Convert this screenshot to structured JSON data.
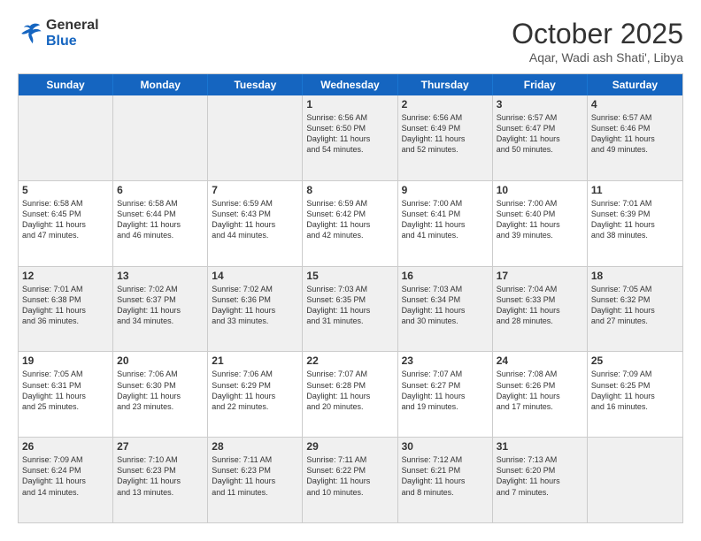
{
  "header": {
    "logo_line1": "General",
    "logo_line2": "Blue",
    "month": "October 2025",
    "location": "Aqar, Wadi ash Shati', Libya"
  },
  "day_headers": [
    "Sunday",
    "Monday",
    "Tuesday",
    "Wednesday",
    "Thursday",
    "Friday",
    "Saturday"
  ],
  "weeks": [
    [
      {
        "day": "",
        "info": ""
      },
      {
        "day": "",
        "info": ""
      },
      {
        "day": "",
        "info": ""
      },
      {
        "day": "1",
        "info": "Sunrise: 6:56 AM\nSunset: 6:50 PM\nDaylight: 11 hours\nand 54 minutes."
      },
      {
        "day": "2",
        "info": "Sunrise: 6:56 AM\nSunset: 6:49 PM\nDaylight: 11 hours\nand 52 minutes."
      },
      {
        "day": "3",
        "info": "Sunrise: 6:57 AM\nSunset: 6:47 PM\nDaylight: 11 hours\nand 50 minutes."
      },
      {
        "day": "4",
        "info": "Sunrise: 6:57 AM\nSunset: 6:46 PM\nDaylight: 11 hours\nand 49 minutes."
      }
    ],
    [
      {
        "day": "5",
        "info": "Sunrise: 6:58 AM\nSunset: 6:45 PM\nDaylight: 11 hours\nand 47 minutes."
      },
      {
        "day": "6",
        "info": "Sunrise: 6:58 AM\nSunset: 6:44 PM\nDaylight: 11 hours\nand 46 minutes."
      },
      {
        "day": "7",
        "info": "Sunrise: 6:59 AM\nSunset: 6:43 PM\nDaylight: 11 hours\nand 44 minutes."
      },
      {
        "day": "8",
        "info": "Sunrise: 6:59 AM\nSunset: 6:42 PM\nDaylight: 11 hours\nand 42 minutes."
      },
      {
        "day": "9",
        "info": "Sunrise: 7:00 AM\nSunset: 6:41 PM\nDaylight: 11 hours\nand 41 minutes."
      },
      {
        "day": "10",
        "info": "Sunrise: 7:00 AM\nSunset: 6:40 PM\nDaylight: 11 hours\nand 39 minutes."
      },
      {
        "day": "11",
        "info": "Sunrise: 7:01 AM\nSunset: 6:39 PM\nDaylight: 11 hours\nand 38 minutes."
      }
    ],
    [
      {
        "day": "12",
        "info": "Sunrise: 7:01 AM\nSunset: 6:38 PM\nDaylight: 11 hours\nand 36 minutes."
      },
      {
        "day": "13",
        "info": "Sunrise: 7:02 AM\nSunset: 6:37 PM\nDaylight: 11 hours\nand 34 minutes."
      },
      {
        "day": "14",
        "info": "Sunrise: 7:02 AM\nSunset: 6:36 PM\nDaylight: 11 hours\nand 33 minutes."
      },
      {
        "day": "15",
        "info": "Sunrise: 7:03 AM\nSunset: 6:35 PM\nDaylight: 11 hours\nand 31 minutes."
      },
      {
        "day": "16",
        "info": "Sunrise: 7:03 AM\nSunset: 6:34 PM\nDaylight: 11 hours\nand 30 minutes."
      },
      {
        "day": "17",
        "info": "Sunrise: 7:04 AM\nSunset: 6:33 PM\nDaylight: 11 hours\nand 28 minutes."
      },
      {
        "day": "18",
        "info": "Sunrise: 7:05 AM\nSunset: 6:32 PM\nDaylight: 11 hours\nand 27 minutes."
      }
    ],
    [
      {
        "day": "19",
        "info": "Sunrise: 7:05 AM\nSunset: 6:31 PM\nDaylight: 11 hours\nand 25 minutes."
      },
      {
        "day": "20",
        "info": "Sunrise: 7:06 AM\nSunset: 6:30 PM\nDaylight: 11 hours\nand 23 minutes."
      },
      {
        "day": "21",
        "info": "Sunrise: 7:06 AM\nSunset: 6:29 PM\nDaylight: 11 hours\nand 22 minutes."
      },
      {
        "day": "22",
        "info": "Sunrise: 7:07 AM\nSunset: 6:28 PM\nDaylight: 11 hours\nand 20 minutes."
      },
      {
        "day": "23",
        "info": "Sunrise: 7:07 AM\nSunset: 6:27 PM\nDaylight: 11 hours\nand 19 minutes."
      },
      {
        "day": "24",
        "info": "Sunrise: 7:08 AM\nSunset: 6:26 PM\nDaylight: 11 hours\nand 17 minutes."
      },
      {
        "day": "25",
        "info": "Sunrise: 7:09 AM\nSunset: 6:25 PM\nDaylight: 11 hours\nand 16 minutes."
      }
    ],
    [
      {
        "day": "26",
        "info": "Sunrise: 7:09 AM\nSunset: 6:24 PM\nDaylight: 11 hours\nand 14 minutes."
      },
      {
        "day": "27",
        "info": "Sunrise: 7:10 AM\nSunset: 6:23 PM\nDaylight: 11 hours\nand 13 minutes."
      },
      {
        "day": "28",
        "info": "Sunrise: 7:11 AM\nSunset: 6:23 PM\nDaylight: 11 hours\nand 11 minutes."
      },
      {
        "day": "29",
        "info": "Sunrise: 7:11 AM\nSunset: 6:22 PM\nDaylight: 11 hours\nand 10 minutes."
      },
      {
        "day": "30",
        "info": "Sunrise: 7:12 AM\nSunset: 6:21 PM\nDaylight: 11 hours\nand 8 minutes."
      },
      {
        "day": "31",
        "info": "Sunrise: 7:13 AM\nSunset: 6:20 PM\nDaylight: 11 hours\nand 7 minutes."
      },
      {
        "day": "",
        "info": ""
      }
    ]
  ],
  "shaded_rows": [
    0,
    2,
    4
  ]
}
